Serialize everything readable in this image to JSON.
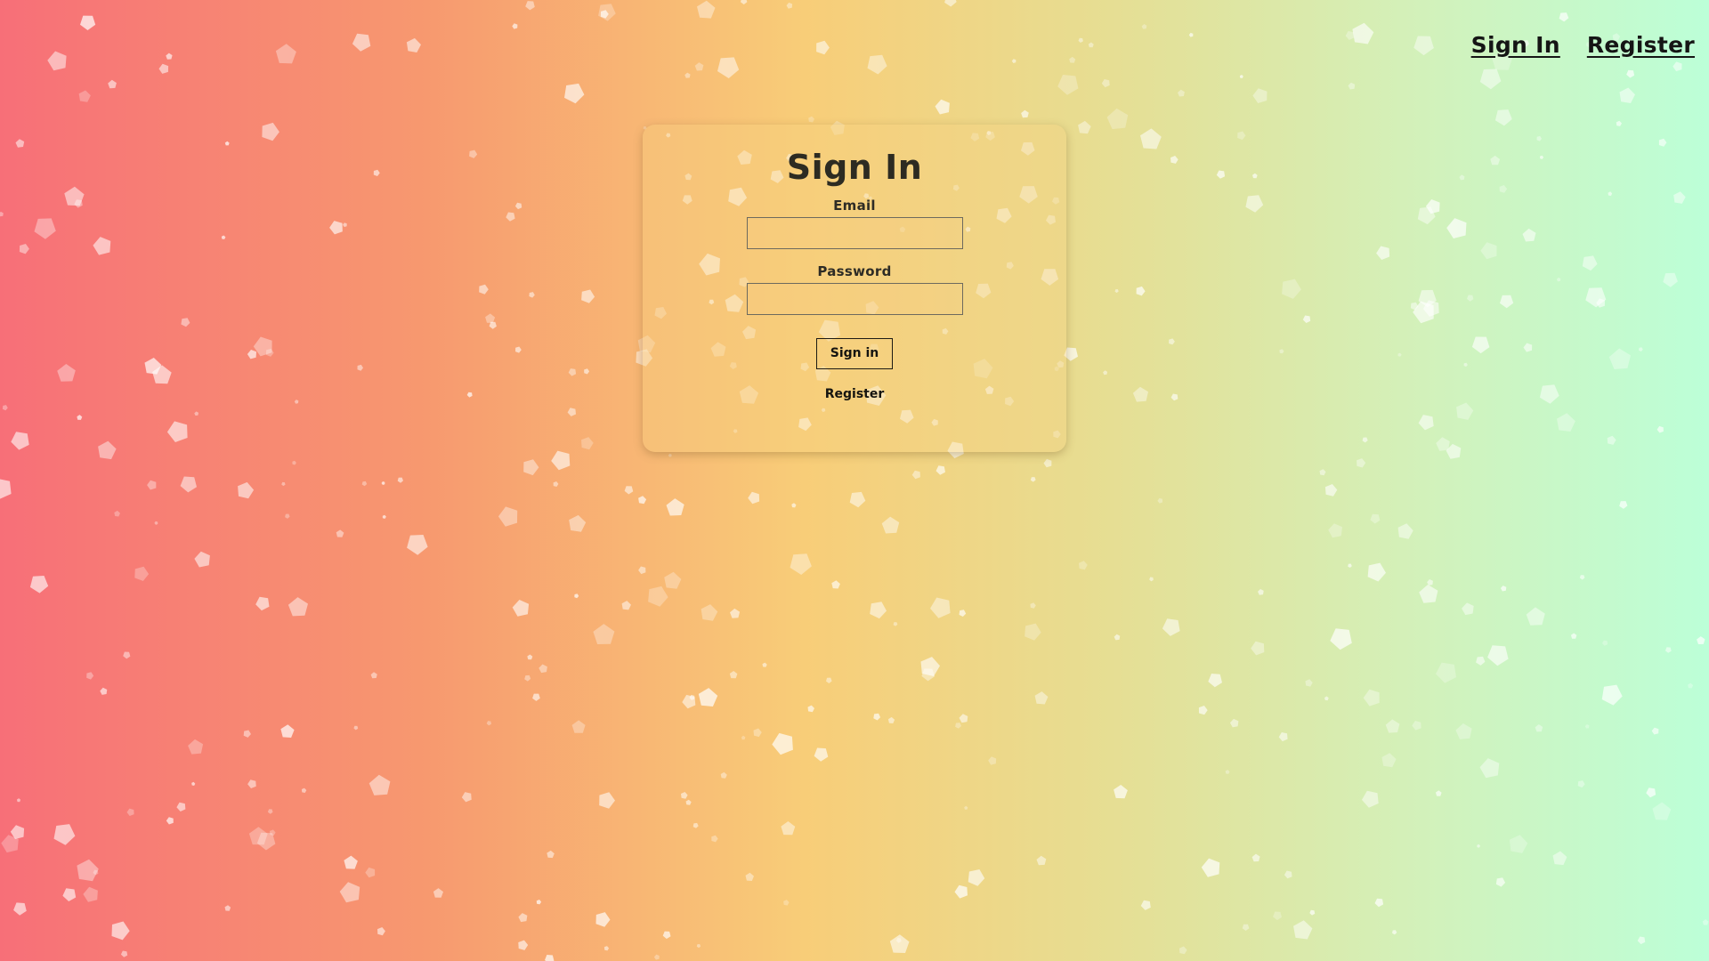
{
  "nav": {
    "sign_in": "Sign In",
    "register": "Register"
  },
  "form": {
    "title": "Sign In",
    "email_label": "Email",
    "email_value": "",
    "password_label": "Password",
    "password_value": "",
    "submit_label": "Sign in",
    "register_link": "Register"
  },
  "colors": {
    "gradient": [
      "#f76f78",
      "#f8cd78",
      "#bcffd8"
    ],
    "text": "#2b2a24",
    "confetti": "#ffffff"
  },
  "decor": {
    "background_particles": "pentagon"
  }
}
